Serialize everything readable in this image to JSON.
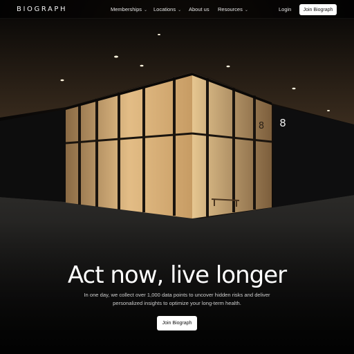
{
  "nav": {
    "logo": "BIOGRAPH",
    "items": [
      {
        "label": "Memberships",
        "has_dropdown": true
      },
      {
        "label": "Locations",
        "has_dropdown": true
      },
      {
        "label": "About us",
        "has_dropdown": false
      },
      {
        "label": "Resources",
        "has_dropdown": true
      }
    ],
    "login_label": "Login",
    "join_label": "Join Biograph"
  },
  "hero": {
    "headline": "Act now, live longer",
    "subtext": "In one day, we collect over 1,000 data points to uncover hidden risks and deliver personalized insights to optimize your long-term health.",
    "cta_label": "Join Biograph",
    "building_glyph": "8",
    "image_description_icon": "building-photo"
  },
  "colors": {
    "background": "#060606",
    "button_bg": "#ffffff",
    "button_text": "#111111",
    "warm_light": "#e8c48a"
  }
}
